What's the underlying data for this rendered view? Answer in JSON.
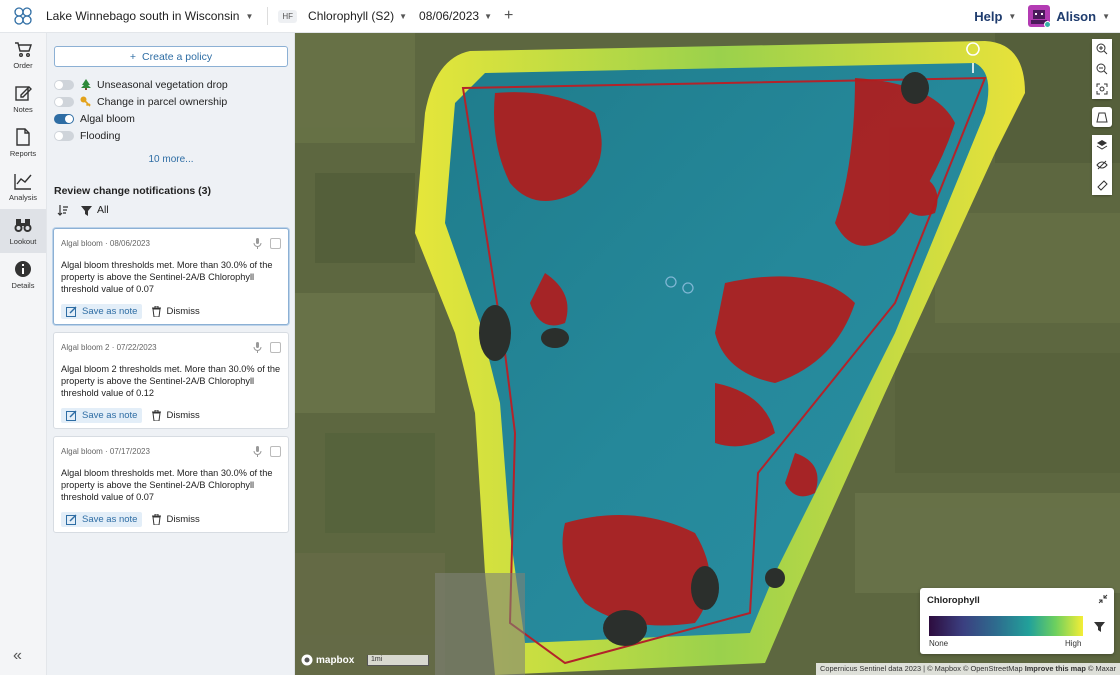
{
  "header": {
    "location": "Lake Winnebago south in Wisconsin",
    "layer_badge": "HF",
    "layer": "Chlorophyll (S2)",
    "date": "08/06/2023",
    "help": "Help",
    "user": "Alison"
  },
  "rail": [
    {
      "label": "Order",
      "icon": "cart-icon"
    },
    {
      "label": "Notes",
      "icon": "note-icon"
    },
    {
      "label": "Reports",
      "icon": "document-icon"
    },
    {
      "label": "Analysis",
      "icon": "chart-line-icon"
    },
    {
      "label": "Lookout",
      "icon": "binoculars-icon"
    },
    {
      "label": "Details",
      "icon": "info-icon"
    }
  ],
  "panel": {
    "create_policy": "Create a policy",
    "policies": [
      {
        "label": "Unseasonal vegetation drop",
        "on": false
      },
      {
        "label": "Change in parcel ownership",
        "on": false
      },
      {
        "label": "Algal bloom",
        "on": true
      },
      {
        "label": "Flooding",
        "on": false
      }
    ],
    "more": "10 more...",
    "review_title": "Review change notifications (3)",
    "filter_all": "All",
    "save_note": "Save as note",
    "dismiss": "Dismiss",
    "cards": [
      {
        "head": "Algal bloom · 08/06/2023",
        "body": "Algal bloom thresholds met. More than 30.0% of the property is above the Sentinel-2A/B Chlorophyll threshold value of 0.07"
      },
      {
        "head": "Algal bloom 2 · 07/22/2023",
        "body": "Algal bloom 2 thresholds met. More than 30.0% of the property is above the Sentinel-2A/B Chlorophyll threshold value of 0.12"
      },
      {
        "head": "Algal bloom · 07/17/2023",
        "body": "Algal bloom thresholds met. More than 30.0% of the property is above the Sentinel-2A/B Chlorophyll threshold value of 0.07"
      }
    ]
  },
  "map": {
    "legend_title": "Chlorophyll",
    "legend_low": "None",
    "legend_high": "High",
    "logo": "mapbox",
    "scale": "1mi",
    "attribution": "Copernicus Sentinel data 2023 | © Mapbox © OpenStreetMap",
    "improve": "Improve this map",
    "attribution_tail": "© Maxar"
  }
}
